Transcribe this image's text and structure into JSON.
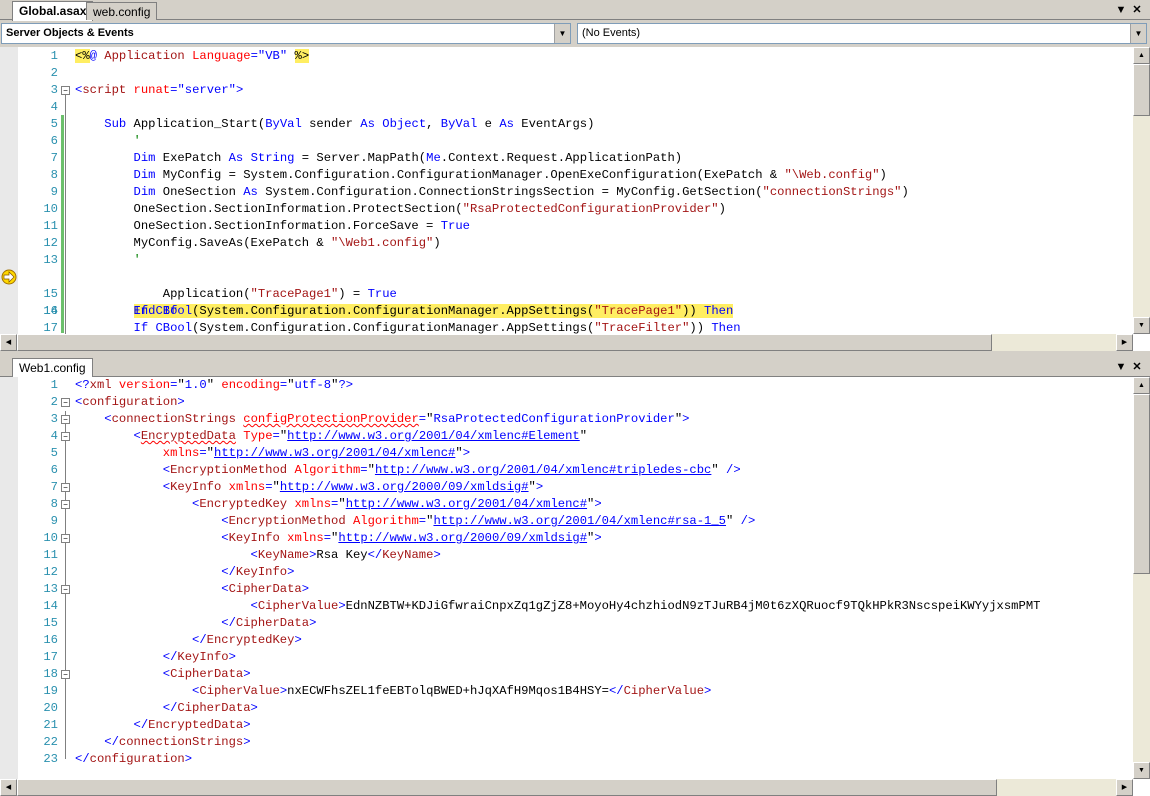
{
  "top_pane": {
    "tabs": [
      {
        "label": "Global.asax",
        "active": true
      },
      {
        "label": "web.config",
        "active": false
      }
    ],
    "object_combo": "Server Objects & Events",
    "event_combo": "(No Events)",
    "line_numbers": [
      "1",
      "2",
      "3",
      "4",
      "5",
      "6",
      "7",
      "8",
      "9",
      "10",
      "11",
      "12",
      "13",
      "14",
      "15",
      "16",
      "17"
    ]
  },
  "bottom_pane": {
    "tabs": [
      {
        "label": "Web1.config",
        "active": true
      }
    ],
    "line_numbers": [
      "1",
      "2",
      "3",
      "4",
      "5",
      "6",
      "7",
      "8",
      "9",
      "10",
      "11",
      "12",
      "13",
      "14",
      "15",
      "16",
      "17",
      "18",
      "19",
      "20",
      "21",
      "22",
      "23"
    ]
  },
  "icons": {
    "dropdown": "chevron-down-icon",
    "close": "close-icon",
    "breakpoint": "current-statement-arrow-icon",
    "collapse": "outline-collapse-icon"
  },
  "colors": {
    "keyword": "#0000ff",
    "string": "#a31515",
    "comment": "#008000",
    "xml_tag": "#a31515",
    "xml_attr": "#ff0000",
    "highlight": "#ffee62",
    "line_number": "#2b91af"
  }
}
